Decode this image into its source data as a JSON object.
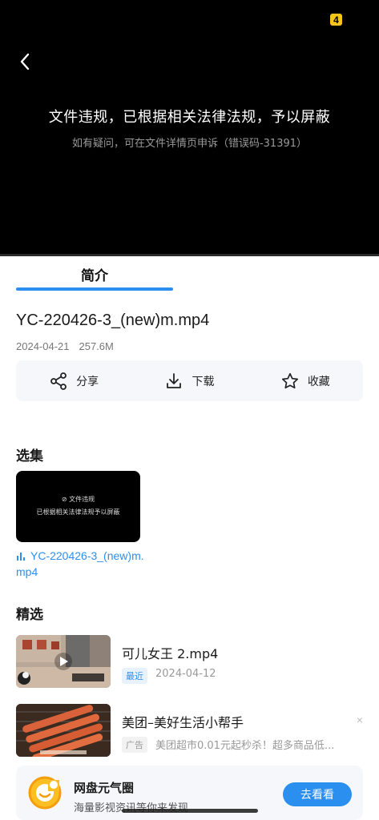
{
  "player": {
    "badge": "4",
    "violation_title": "文件违规，已根据相关法律法规，予以屏蔽",
    "violation_subtitle": "如有疑问，可在文件详情页申诉（错误码-31391）"
  },
  "tabs": [
    {
      "label": "简介"
    }
  ],
  "file": {
    "name": "YC-220426-3_(new)m.mp4",
    "date": "2024-04-21",
    "size": "257.6M"
  },
  "actions": {
    "share": "分享",
    "download": "下载",
    "favorite": "收藏"
  },
  "episodes": {
    "section_title": "选集",
    "thumb_line1": "⊘ 文件违规",
    "thumb_line2": "已根据相关法律法规予以屏蔽",
    "items": [
      {
        "name": "YC-220426-3_(new)m.mp4"
      }
    ]
  },
  "featured": {
    "section_title": "精选",
    "items": [
      {
        "title": "可儿女王 2.mp4",
        "tag": "最近",
        "subtitle": "2024-04-12"
      },
      {
        "title": "美团–美好生活小帮手",
        "tag": "广告",
        "subtitle": "美团超市0.01元起秒杀！超多商品低...",
        "close": "×"
      }
    ]
  },
  "promo": {
    "title": "网盘元气圈",
    "subtitle": "海量影视资讯等你来发现",
    "button": "去看看"
  },
  "colors": {
    "accent": "#2b8ff0",
    "badge": "#f5c518"
  }
}
